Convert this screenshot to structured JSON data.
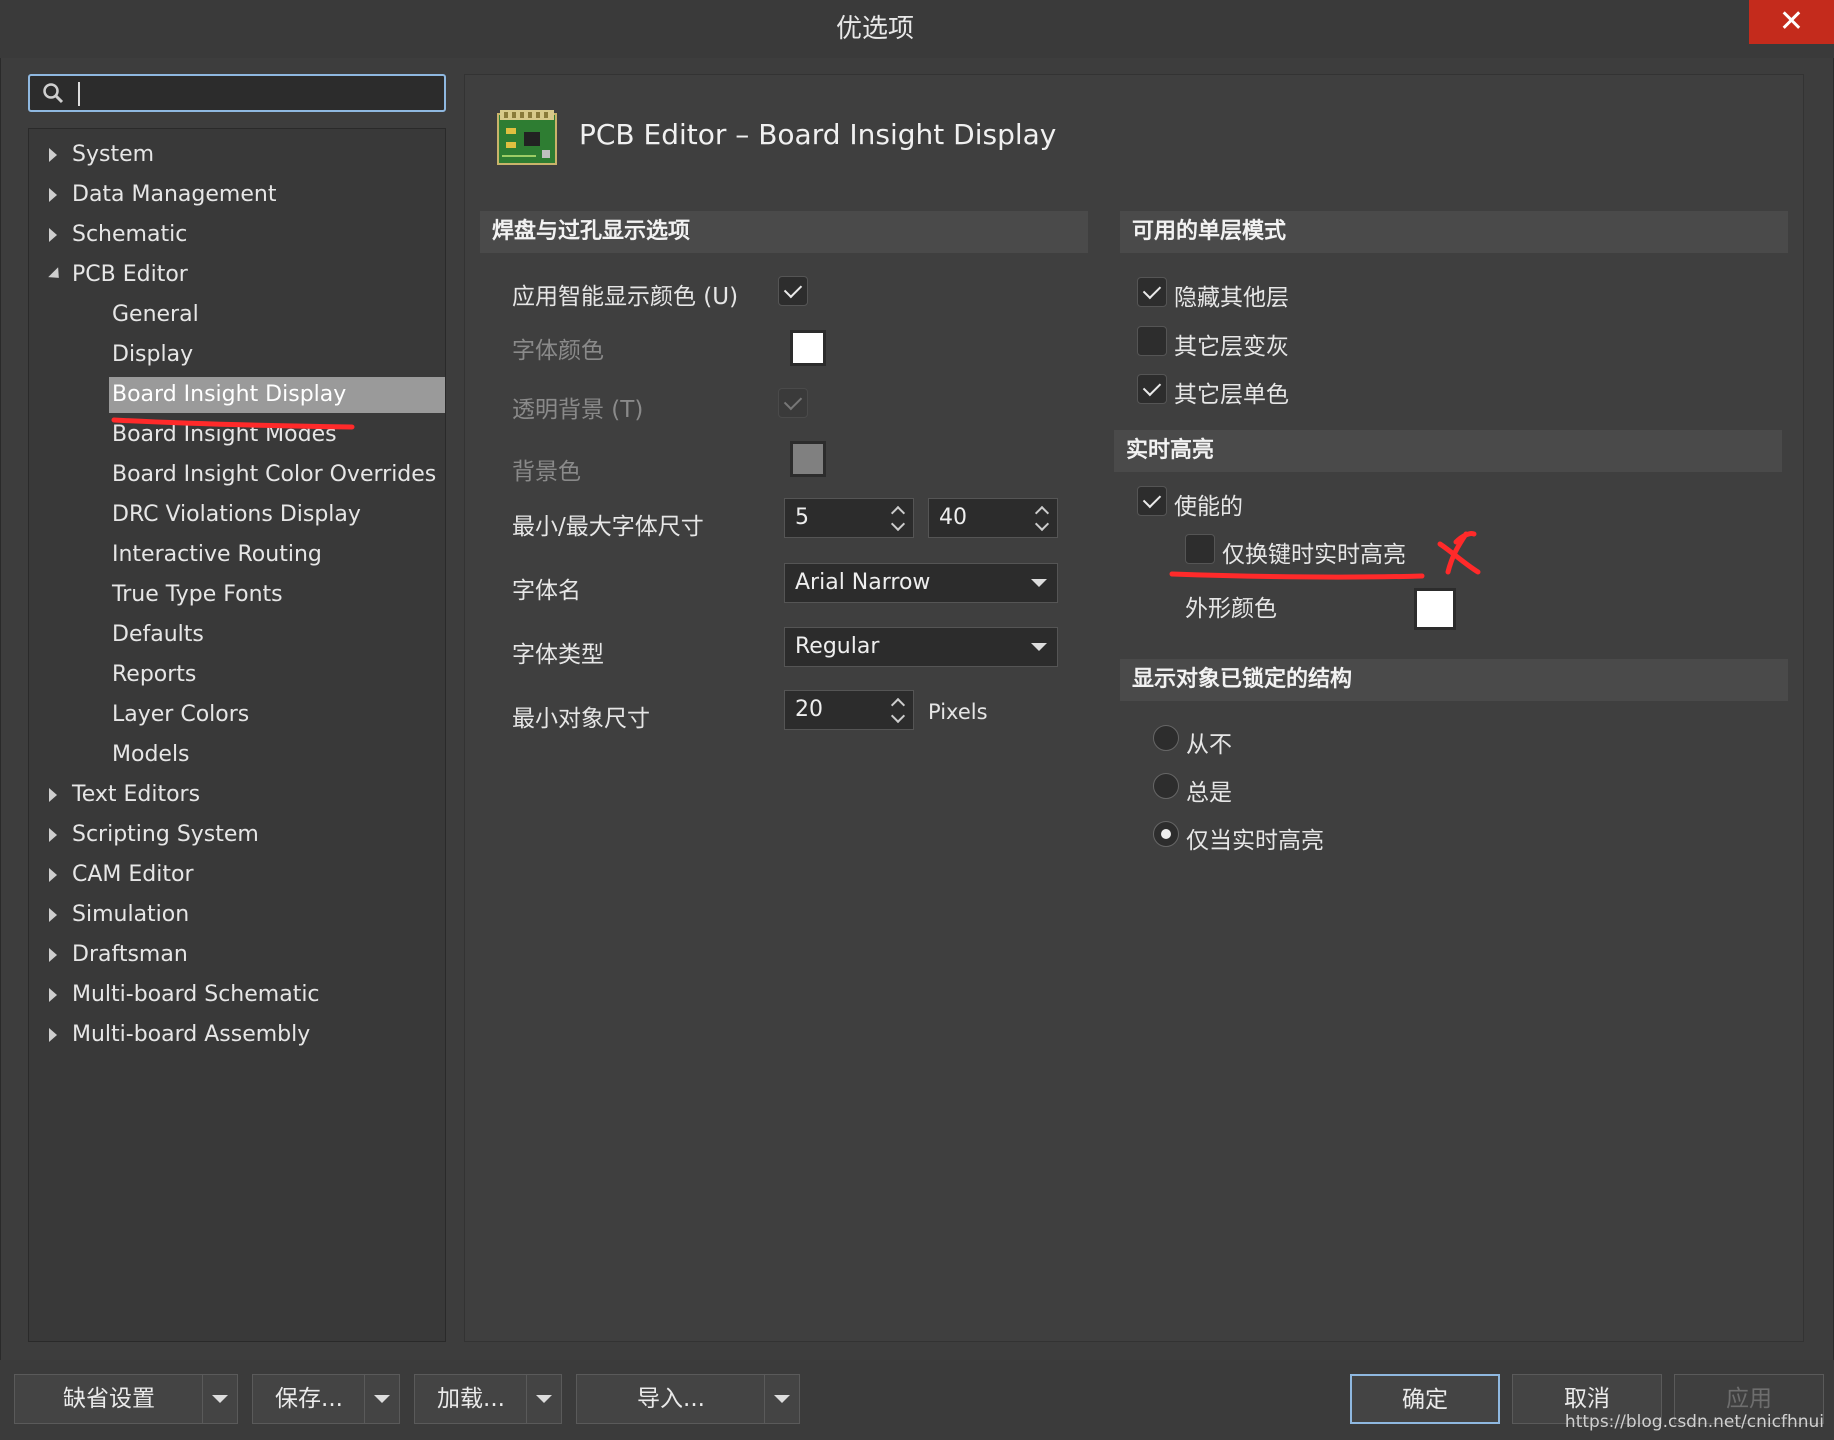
{
  "window": {
    "title": "优选项",
    "close_icon": "close-icon"
  },
  "search": {
    "value": "",
    "placeholder": ""
  },
  "tree": {
    "items": [
      {
        "label": "System",
        "expanded": false,
        "level": 0
      },
      {
        "label": "Data Management",
        "expanded": false,
        "level": 0
      },
      {
        "label": "Schematic",
        "expanded": false,
        "level": 0
      },
      {
        "label": "PCB Editor",
        "expanded": true,
        "level": 0
      },
      {
        "label": "General",
        "level": 1
      },
      {
        "label": "Display",
        "level": 1
      },
      {
        "label": "Board Insight Display",
        "level": 1,
        "selected": true
      },
      {
        "label": "Board Insight Modes",
        "level": 1
      },
      {
        "label": "Board Insight Color Overrides",
        "level": 1
      },
      {
        "label": "DRC Violations Display",
        "level": 1
      },
      {
        "label": "Interactive Routing",
        "level": 1
      },
      {
        "label": "True Type Fonts",
        "level": 1
      },
      {
        "label": "Defaults",
        "level": 1
      },
      {
        "label": "Reports",
        "level": 1
      },
      {
        "label": "Layer Colors",
        "level": 1
      },
      {
        "label": "Models",
        "level": 1
      },
      {
        "label": "Text Editors",
        "expanded": false,
        "level": 0
      },
      {
        "label": "Scripting System",
        "expanded": false,
        "level": 0
      },
      {
        "label": "CAM Editor",
        "expanded": false,
        "level": 0
      },
      {
        "label": "Simulation",
        "expanded": false,
        "level": 0
      },
      {
        "label": "Draftsman",
        "expanded": false,
        "level": 0
      },
      {
        "label": "Multi-board Schematic",
        "expanded": false,
        "level": 0
      },
      {
        "label": "Multi-board Assembly",
        "expanded": false,
        "level": 0
      }
    ]
  },
  "page": {
    "title": "PCB Editor – Board Insight Display"
  },
  "pad_via": {
    "section": "焊盘与过孔显示选项",
    "smart_color": {
      "label": "应用智能显示颜色 (U)",
      "checked": true
    },
    "font_color": {
      "label": "字体颜色",
      "color": "#ffffff"
    },
    "transparent_bg": {
      "label": "透明背景 (T)",
      "checked": true
    },
    "bg_color": {
      "label": "背景色",
      "color": "#808080"
    },
    "font_size": {
      "label": "最小/最大字体尺寸",
      "min": "5",
      "max": "40"
    },
    "font_name": {
      "label": "字体名",
      "value": "Arial Narrow"
    },
    "font_type": {
      "label": "字体类型",
      "value": "Regular"
    },
    "min_object": {
      "label": "最小对象尺寸",
      "value": "20",
      "unit": "Pixels"
    }
  },
  "single_layer": {
    "section": "可用的单层模式",
    "hide_others": {
      "label": "隐藏其他层",
      "checked": true
    },
    "gray_others": {
      "label": "其它层变灰",
      "checked": false
    },
    "mono_others": {
      "label": "其它层单色",
      "checked": true
    }
  },
  "live_highlight": {
    "section": "实时高亮",
    "enabled": {
      "label": "使能的",
      "checked": true
    },
    "shift_only": {
      "label": "仅换键时实时高亮",
      "checked": false
    },
    "outline_color": {
      "label": "外形颜色",
      "color": "#ffffff"
    }
  },
  "locked": {
    "section": "显示对象已锁定的结构",
    "options": [
      {
        "label": "从不",
        "selected": false
      },
      {
        "label": "总是",
        "selected": false
      },
      {
        "label": "仅当实时高亮",
        "selected": true
      }
    ]
  },
  "buttons": {
    "defaults": "缺省设置",
    "save": "保存...",
    "load": "加载...",
    "import": "导入...",
    "ok": "确定",
    "cancel": "取消",
    "apply": "应用"
  },
  "watermark": "https://blog.csdn.net/cnicfhnui",
  "colors": {
    "accent": "#8fb8e0",
    "close": "#c42b1c",
    "annotation": "#ff2a2a"
  }
}
